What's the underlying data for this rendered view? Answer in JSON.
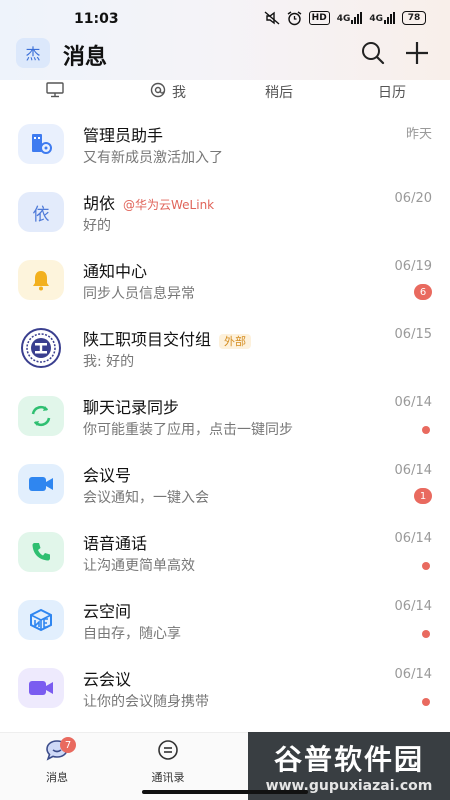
{
  "status_bar": {
    "time": "11:03",
    "hd_label": "HD",
    "net1": "4G",
    "net2": "4G",
    "battery": "78"
  },
  "header": {
    "avatar_text": "杰",
    "title": "消息"
  },
  "filter_tabs": [
    {
      "label": ""
    },
    {
      "label": "我"
    },
    {
      "label": "稍后"
    },
    {
      "label": "日历"
    }
  ],
  "conversations": [
    {
      "name": "管理员助手",
      "preview": "又有新成员激活加入了",
      "date": "昨天",
      "icon": "admin-assistant-icon",
      "color": "#3e7bf0"
    },
    {
      "name": "胡依",
      "tag": "@华为云WeLink",
      "preview": "好的",
      "date": "06/20",
      "avatar_text": "依",
      "color": "#4d79d8"
    },
    {
      "name": "通知中心",
      "preview": "同步人员信息异常",
      "date": "06/19",
      "badge": "6",
      "icon": "bell-icon",
      "color": "#f2b01e"
    },
    {
      "name": "陕工职项目交付组",
      "tag": "外部",
      "preview": "我: 好的",
      "date": "06/15",
      "icon": "group-logo",
      "color": "#3a3f8f"
    },
    {
      "name": "聊天记录同步",
      "preview": "你可能重装了应用，点击一键同步",
      "date": "06/14",
      "dot": true,
      "icon": "sync-icon",
      "color": "#2fbf71"
    },
    {
      "name": "会议号",
      "preview": "会议通知，一键入会",
      "date": "06/14",
      "badge": "1",
      "icon": "camera-icon",
      "color": "#2f86f0"
    },
    {
      "name": "语音通话",
      "preview": "让沟通更简单高效",
      "date": "06/14",
      "dot": true,
      "icon": "phone-icon",
      "color": "#2fbf71"
    },
    {
      "name": "云空间",
      "preview": "自由存，随心享",
      "date": "06/14",
      "dot": true,
      "icon": "cloud-space-icon",
      "color": "#2f86f0"
    },
    {
      "name": "云会议",
      "preview": "让你的会议随身携带",
      "date": "06/14",
      "dot": true,
      "icon": "video-conference-icon",
      "color": "#7a5cf0"
    }
  ],
  "bottom_nav": [
    {
      "label": "消息",
      "badge": "7"
    },
    {
      "label": "通讯录"
    }
  ],
  "watermark": {
    "main": "谷普软件园",
    "url": "www.gupuxiazai.com"
  }
}
